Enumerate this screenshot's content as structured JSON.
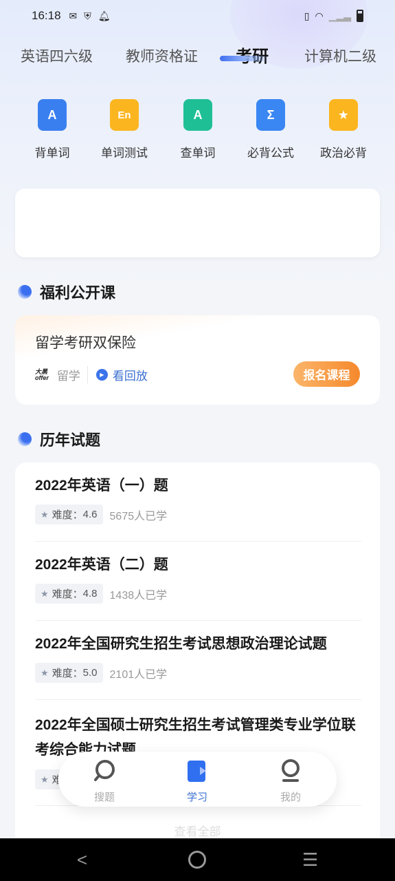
{
  "status_bar": {
    "time": "16:18",
    "icons": [
      "mail-icon",
      "shield-icon",
      "bell-icon",
      "vibrate-icon",
      "wifi-icon",
      "signal-icon",
      "battery-icon"
    ]
  },
  "tabs": [
    {
      "label": "英语四六级"
    },
    {
      "label": "教师资格证"
    },
    {
      "label": "考研",
      "active": true
    },
    {
      "label": "计算机二级"
    }
  ],
  "tools": [
    {
      "label": "背单词",
      "icon": "book-a-icon",
      "color": "#3a7ff0"
    },
    {
      "label": "单词测试",
      "icon": "en-test-icon",
      "color": "#fbb51f"
    },
    {
      "label": "查单词",
      "icon": "search-word-icon",
      "color": "#1fbf96"
    },
    {
      "label": "必背公式",
      "icon": "sigma-icon",
      "color": "#3a86f2"
    },
    {
      "label": "政治必背",
      "icon": "politics-icon",
      "color": "#fbb51f"
    }
  ],
  "sections": {
    "open_course": "福利公开课",
    "past_exams": "历年试题"
  },
  "course": {
    "title": "留学考研双保险",
    "logo_text": "大黑 offer",
    "school": "留学",
    "replay": "看回放",
    "enroll": "报名课程"
  },
  "exams": [
    {
      "title": "2022年英语（一）题",
      "difficulty_label": "难度：",
      "difficulty": "4.6",
      "learners": "5675人已学"
    },
    {
      "title": "2022年英语（二）题",
      "difficulty_label": "难度：",
      "difficulty": "4.8",
      "learners": "1438人已学"
    },
    {
      "title": "2022年全国研究生招生考试思想政治理论试题",
      "difficulty_label": "难度：",
      "difficulty": "5.0",
      "learners": "2101人已学"
    },
    {
      "title": "2022年全国硕士研究生招生考试管理类专业学位联考综合能力试题",
      "difficulty_label": "难"
    }
  ],
  "view_all": "查看全部",
  "bottom_nav": [
    {
      "label": "搜题",
      "icon": "search-icon"
    },
    {
      "label": "学习",
      "icon": "study-icon",
      "active": true
    },
    {
      "label": "我的",
      "icon": "profile-icon"
    }
  ],
  "colors": {
    "accent": "#3b6fd0",
    "enroll": "#f5892c"
  }
}
